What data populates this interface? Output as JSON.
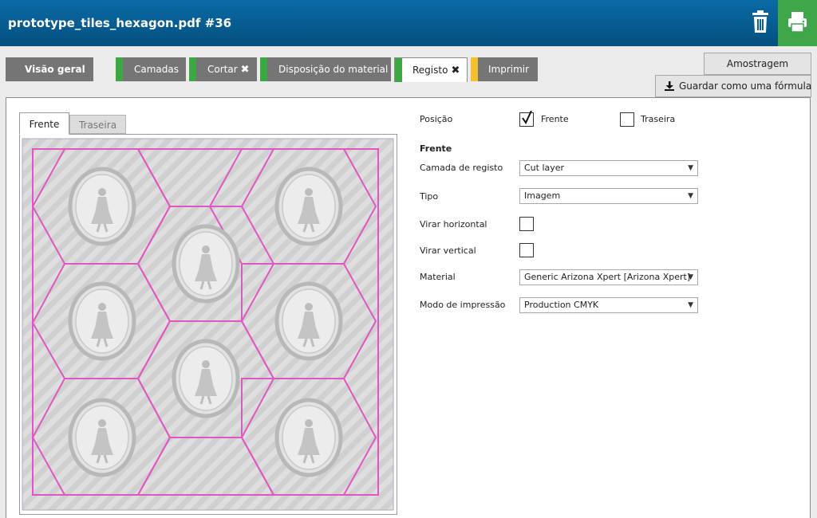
{
  "header": {
    "title": "prototype_tiles_hexagon.pdf #36",
    "trash_icon": "trash-icon",
    "print_icon": "printer-icon",
    "print_bg": "#3fa64a"
  },
  "tabs": {
    "overview": "Visão geral",
    "layers": "Camadas",
    "cut": "Cortar",
    "layout": "Disposição do material",
    "registration": "Registo",
    "print": "Imprimir",
    "status_colors": {
      "ok": "#3ba844",
      "warning": "#f5c02e"
    }
  },
  "actions": {
    "sampling": "Amostragem",
    "save_formula": "Guardar como uma fórmula"
  },
  "side_tabs": {
    "front": "Frente",
    "back": "Traseira"
  },
  "form": {
    "position_label": "Posição",
    "position_front": "Frente",
    "position_back": "Traseira",
    "front_checked": true,
    "back_checked": false,
    "section_title": "Frente",
    "reg_layer_label": "Camada de registo",
    "reg_layer_value": "Cut layer",
    "type_label": "Tipo",
    "type_value": "Imagem",
    "flip_h_label": "Virar horizontal",
    "flip_v_label": "Virar vertical",
    "material_label": "Material",
    "material_value": "Generic Arizona Xpert [Arizona Xpert]",
    "print_mode_label": "Modo de impressão",
    "print_mode_value": "Production CMYK"
  }
}
